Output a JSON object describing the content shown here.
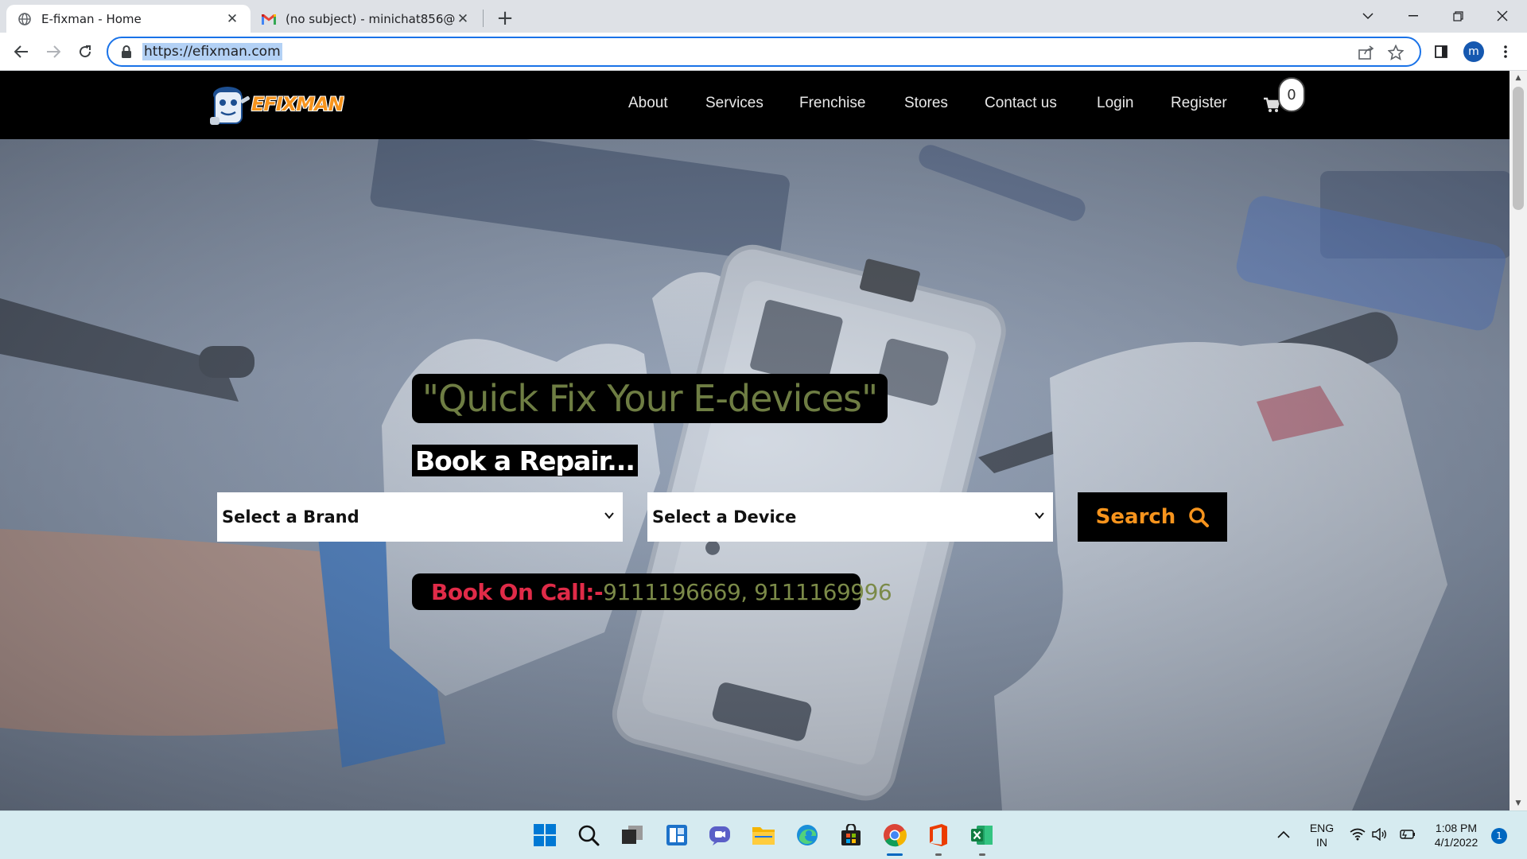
{
  "browser": {
    "tabs": [
      {
        "title": "E-fixman - Home",
        "icon": "globe-icon",
        "active": true
      },
      {
        "title": "(no subject) - minichat856@gmail.com",
        "icon": "gmail-icon",
        "active": false
      }
    ],
    "url": "https://efixman.com",
    "profile_initial": "m"
  },
  "site": {
    "logo_text": "EFIXMAN",
    "nav": [
      "About",
      "Services",
      "Frenchise",
      "Stores",
      "Contact us",
      "Login",
      "Register"
    ],
    "cart_count": "0",
    "headline": "\"Quick Fix Your E-devices\"",
    "book_repair": "Book a Repair...",
    "brand_select": "Select a Brand",
    "device_select": "Select a Device",
    "search_label": "Search",
    "call_label": "Book On Call:-",
    "call_numbers": "9111196669,  9111169996",
    "colors": {
      "brand_orange": "#f7941d",
      "headline_olive": "#6e7d43",
      "call_red": "#e02b48",
      "nav_bg": "#000000"
    }
  },
  "taskbar": {
    "apps": [
      "start-icon",
      "search-icon",
      "task-view-icon",
      "widgets-icon",
      "teams-chat-icon",
      "file-explorer-icon",
      "edge-icon",
      "store-icon",
      "chrome-icon",
      "office-icon",
      "excel-icon"
    ],
    "language": "ENG",
    "region": "IN",
    "time": "1:08 PM",
    "date": "4/1/2022",
    "notifications": "1"
  }
}
